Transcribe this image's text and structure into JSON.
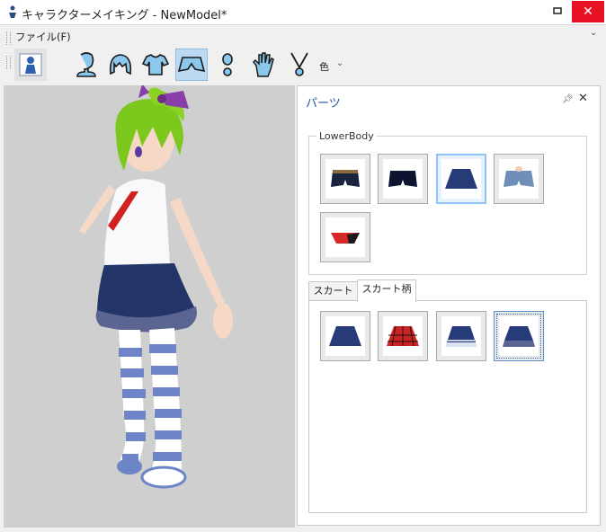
{
  "window": {
    "title": "キャラクターメイキング - NewModel*"
  },
  "menu": {
    "file_label": "ファイル(F)"
  },
  "toolbar": {
    "tools": [
      "character-icon",
      "blank",
      "head-icon",
      "hair-icon",
      "shirt-icon",
      "lowerbody-icon",
      "shoe-icon",
      "hand-icon",
      "necklace-icon"
    ],
    "selected_tool": "lowerbody-icon",
    "color_label": "色"
  },
  "panel": {
    "title": "パーツ",
    "group_label": "LowerBody",
    "parts": [
      {
        "name": "shorts-belt"
      },
      {
        "name": "shorts-navy"
      },
      {
        "name": "skirt-navy",
        "selected": true
      },
      {
        "name": "denim-shorts"
      },
      {
        "name": "bikini-bottom"
      }
    ],
    "tabs": [
      {
        "label": "スカート",
        "active": false
      },
      {
        "label": "スカート柄",
        "active": true
      }
    ],
    "patterns": [
      {
        "name": "pattern-navy"
      },
      {
        "name": "pattern-red-plaid"
      },
      {
        "name": "pattern-navy-white-frill"
      },
      {
        "name": "pattern-navy-lace",
        "selected": true
      }
    ]
  },
  "colors": {
    "accent": "#1c5aa8",
    "close_red": "#e81123",
    "selection": "#bcd9f2",
    "viewport_bg": "#cfcfcf"
  }
}
